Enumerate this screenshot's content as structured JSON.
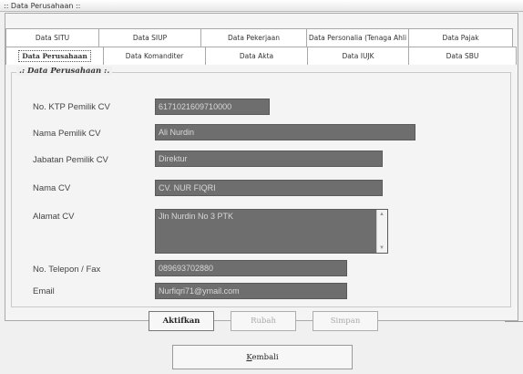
{
  "window": {
    "title": ":: Data Perusahaan ::"
  },
  "tabs": {
    "row_back": [
      "Data SITU",
      "Data SIUP",
      "Data Pekerjaan",
      "Data Personalia (Tenaga Ahli",
      "Data Pajak"
    ],
    "row_front": [
      "Data Perusahaan",
      "Data Komanditer",
      "Data Akta",
      "Data IUJK",
      "Data SBU"
    ],
    "active": "Data Perusahaan"
  },
  "group": {
    "title": ".: Data Perusahaan :."
  },
  "form": {
    "ktp_label": "No. KTP Pemilik CV",
    "ktp_value": "6171021609710000",
    "nama_pemilik_label": "Nama Pemilik CV",
    "nama_pemilik_value": "Ali Nurdin",
    "jabatan_label": "Jabatan Pemilik CV",
    "jabatan_value": "Direktur",
    "nama_cv_label": "Nama CV",
    "nama_cv_value": "CV. NUR FIQRI",
    "alamat_label": "Alamat CV",
    "alamat_value": "Jln Nurdin No 3 PTK",
    "telepon_label": "No. Telepon / Fax",
    "telepon_value": "089693702880",
    "email_label": "Email",
    "email_value": "Nurfiqri71@ymail.com"
  },
  "buttons": {
    "aktifkan": "Aktifkan",
    "ubah": "Rubah",
    "simpan": "Simpan",
    "kembali": "Kembali"
  }
}
